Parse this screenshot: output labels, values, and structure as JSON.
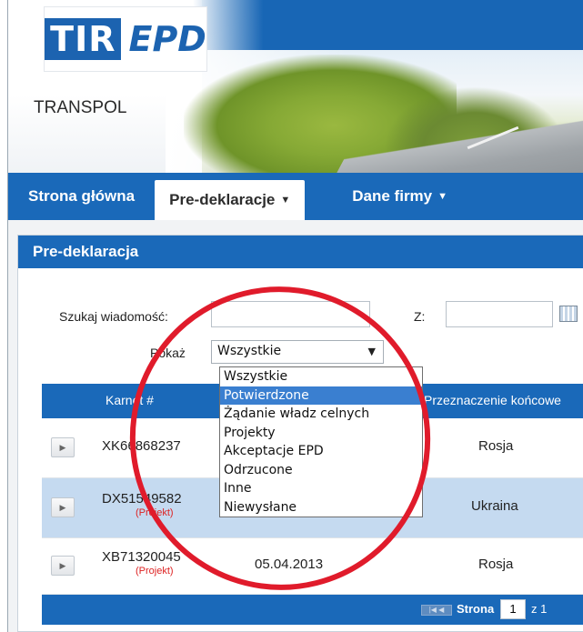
{
  "colors": {
    "brand_blue": "#1a69b9",
    "annotation_red": "#e01b2b",
    "project_red": "#dd2222",
    "selected_option": "#3a7fd0"
  },
  "logo": {
    "tir": "TIR",
    "epd": "EPD"
  },
  "company": "TRANSPOL",
  "nav": {
    "home": "Strona główna",
    "predeclarations": "Pre-deklaracje",
    "company_data": "Dane firmy",
    "caret": "▼"
  },
  "panel": {
    "title": "Pre-deklaracja"
  },
  "filters": {
    "search_label": "Szukaj wiadomość:",
    "from_label": "Z:",
    "show_label": "Pokaż",
    "show_value": "Wszystkie",
    "calendar_icon": "calendar-icon"
  },
  "dropdown": {
    "options": [
      "Wszystkie",
      "Potwierdzone",
      "Żądanie władz celnych",
      "Projekty",
      "Akceptacje EPD",
      "Odrzucone",
      "Inne",
      "Niewysłane"
    ],
    "selected_index": 1
  },
  "table": {
    "headers": {
      "karnet": "Karnet #",
      "destination": "Przeznaczenie końcowe"
    },
    "rows": [
      {
        "karnet": "XK66868237",
        "project": "",
        "date": "",
        "destination": "Rosja"
      },
      {
        "karnet": "DX51549582",
        "project": "(Projekt)",
        "date": "",
        "destination": "Ukraina"
      },
      {
        "karnet": "XB71320045",
        "project": "(Projekt)",
        "date": "05.04.2013",
        "destination": "Rosja"
      }
    ]
  },
  "pager": {
    "label": "Strona",
    "page": "1",
    "of": "z 1"
  }
}
